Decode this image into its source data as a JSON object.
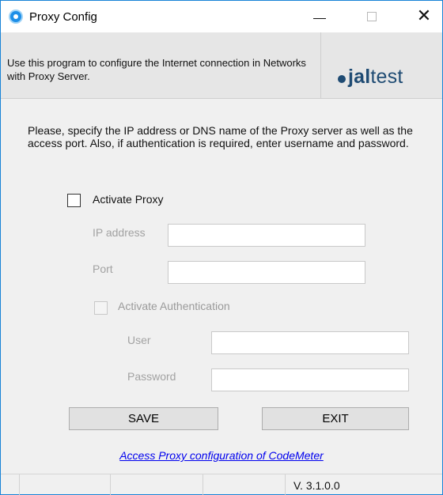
{
  "window": {
    "title": "Proxy Config",
    "controls": {
      "minimize": "—",
      "maximize": "☐",
      "close": "✕"
    }
  },
  "header": {
    "description": "Use this program to configure the Internet connection in Networks with Proxy Server.",
    "logo": {
      "strong": "jal",
      "light": "test",
      "color": "#1f4b73",
      "icon": "dot-logo-icon"
    }
  },
  "instructions": "Please, specify the IP address or DNS name of the Proxy server as well as the access port. Also, if authentication is required, enter username and password.",
  "proxy": {
    "activate_label": "Activate Proxy",
    "activate_checked": false,
    "ip_label": "IP address",
    "ip_value": "",
    "port_label": "Port",
    "port_value": ""
  },
  "auth": {
    "activate_label": "Activate Authentication",
    "activate_checked": false,
    "enabled": false,
    "user_label": "User",
    "user_value": "",
    "password_label": "Password",
    "password_value": ""
  },
  "buttons": {
    "save": "SAVE",
    "exit": "EXIT"
  },
  "link": "Access Proxy configuration of CodeMeter",
  "status": {
    "version": "V. 3.1.0.0"
  },
  "colors": {
    "accent_border": "#1883d7",
    "link": "#0000ee",
    "background": "#f0f0f0"
  }
}
